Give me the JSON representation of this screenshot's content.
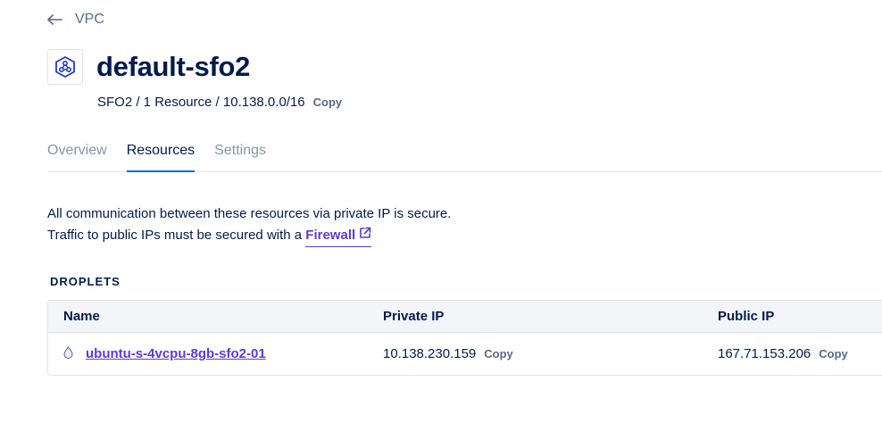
{
  "back": {
    "label": "VPC",
    "icon": "arrow-left-icon"
  },
  "header": {
    "icon": "vpc-network-icon",
    "title": "default-sfo2",
    "meta": "SFO2 / 1 Resource / 10.138.0.0/16",
    "copy_label": "Copy"
  },
  "tabs": [
    {
      "label": "Overview",
      "active": false
    },
    {
      "label": "Resources",
      "active": true
    },
    {
      "label": "Settings",
      "active": false
    }
  ],
  "info": {
    "line1": "All communication between these resources via private IP is secure.",
    "line2": "Traffic to public IPs must be secured with a",
    "firewall_link": "Firewall"
  },
  "droplets": {
    "section_label": "DROPLETS",
    "columns": [
      "Name",
      "Private IP",
      "Public IP"
    ],
    "rows": [
      {
        "icon": "droplet-icon",
        "name": "ubuntu-s-4vcpu-8gb-sfo2-01",
        "private_ip": "10.138.230.159",
        "public_ip": "167.71.153.206",
        "copy_label": "Copy"
      }
    ]
  },
  "colors": {
    "primary_text": "#031b4e",
    "link": "#5c3bd8",
    "tab_active": "#0069ff",
    "muted": "#8a93a6"
  }
}
